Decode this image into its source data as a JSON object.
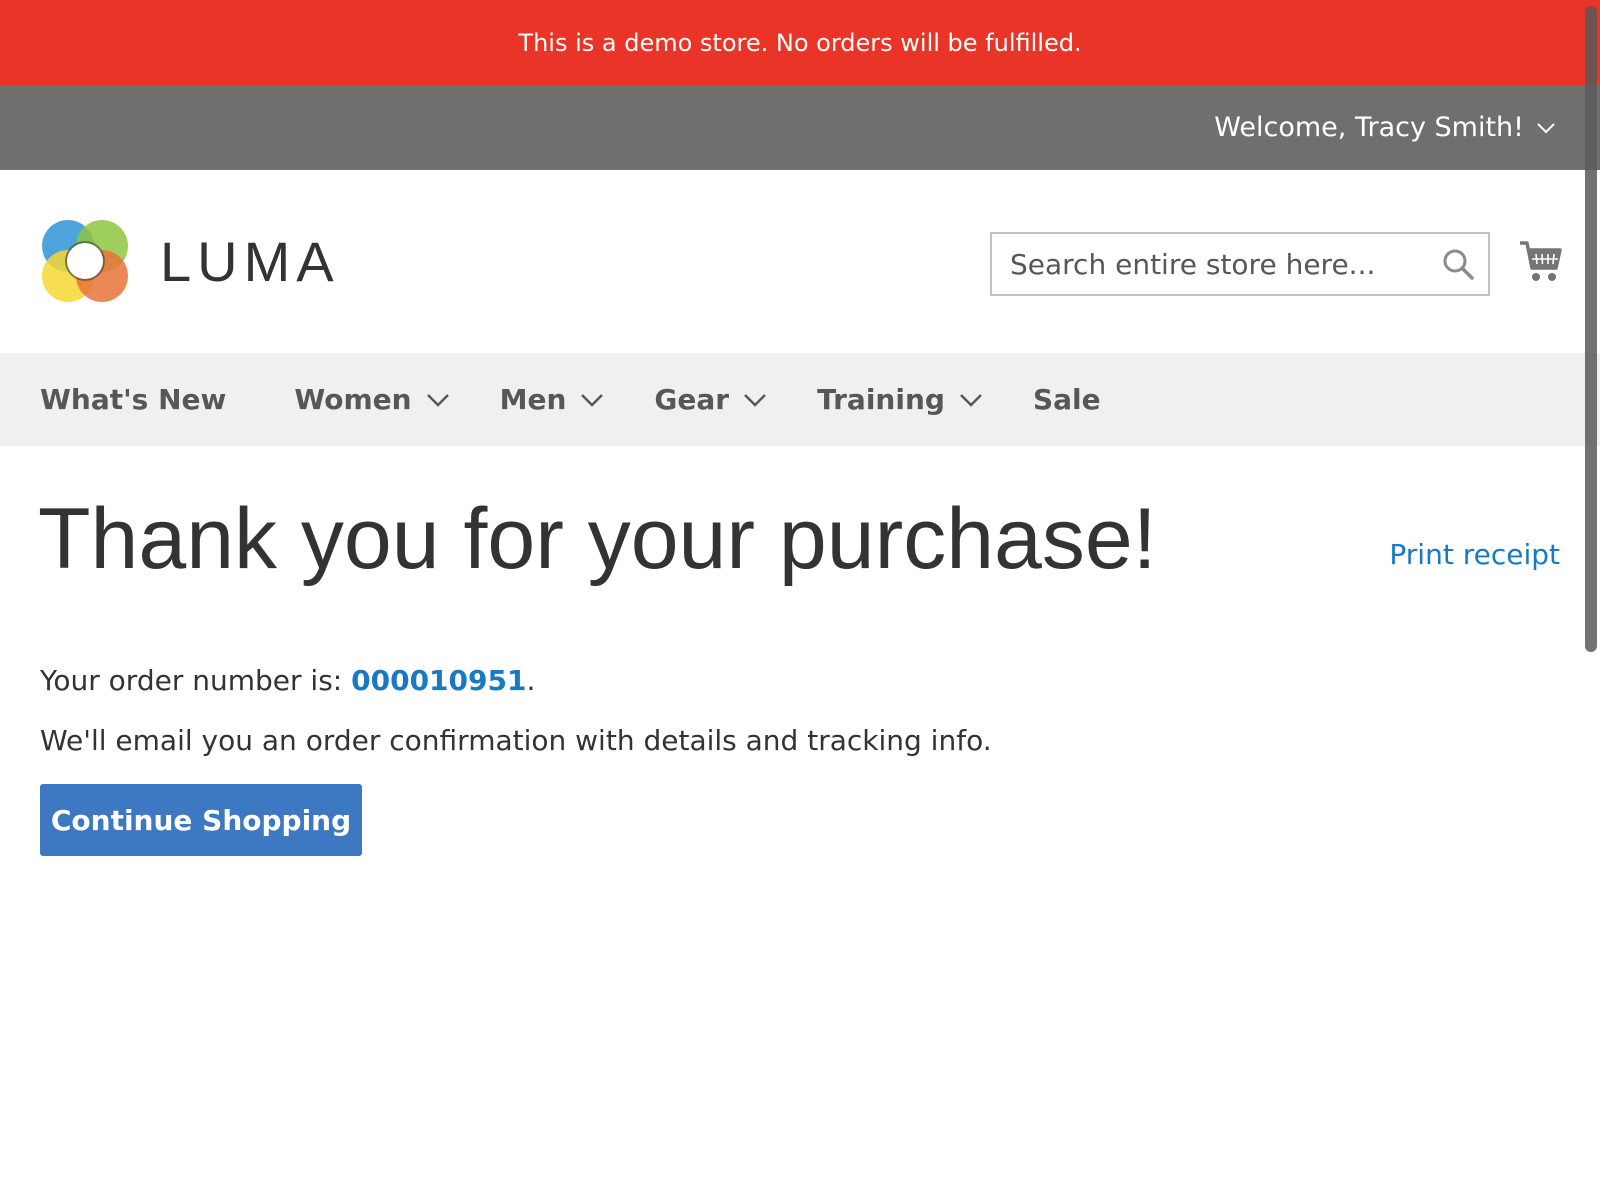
{
  "demo_notice": "This is a demo store. No orders will be fulfilled.",
  "header_panel": {
    "welcome_text": "Welcome, Tracy Smith!"
  },
  "logo": {
    "text": "LUMA"
  },
  "search": {
    "placeholder": "Search entire store here..."
  },
  "nav": {
    "items": [
      {
        "label": "What's New",
        "has_dropdown": false
      },
      {
        "label": "Women",
        "has_dropdown": true
      },
      {
        "label": "Men",
        "has_dropdown": true
      },
      {
        "label": "Gear",
        "has_dropdown": true
      },
      {
        "label": "Training",
        "has_dropdown": true
      },
      {
        "label": "Sale",
        "has_dropdown": false
      }
    ]
  },
  "main": {
    "title": "Thank you for your purchase!",
    "print_receipt": "Print receipt",
    "order_prefix": "Your order number is: ",
    "order_number": "000010951",
    "order_suffix": ".",
    "email_message": "We'll email you an order confirmation with details and tracking info.",
    "continue_button": "Continue Shopping"
  },
  "colors": {
    "demo_notice_bg": "#e93427",
    "panel_bg": "#6f706e",
    "nav_bg": "#f0f0f0",
    "link": "#1979c3",
    "primary_button": "#3d78c3"
  },
  "icons": [
    "chevron-down-icon",
    "luma-logo-icon",
    "search-icon",
    "cart-icon"
  ]
}
